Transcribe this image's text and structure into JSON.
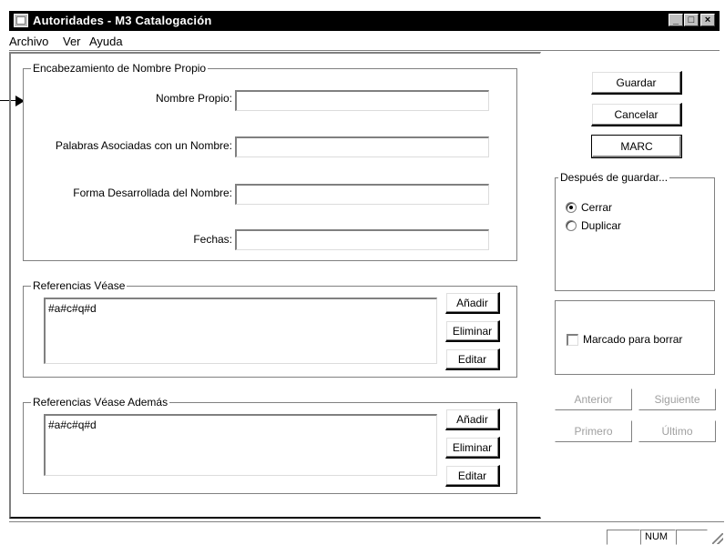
{
  "window": {
    "title": "Autoridades  - M3 Catalogación",
    "minimize_glyph": "_",
    "maximize_glyph": "□",
    "close_glyph": "×"
  },
  "menu": {
    "items": [
      "Archivo",
      "Ver",
      "Ayuda"
    ]
  },
  "heading_group": {
    "label": "Encabezamiento de Nombre Propio",
    "fields": [
      {
        "label": "Nombre Propio:",
        "value": ""
      },
      {
        "label": "Palabras Asociadas con un Nombre:",
        "value": ""
      },
      {
        "label": "Forma Desarrollada del Nombre:",
        "value": ""
      },
      {
        "label": "Fechas:",
        "value": ""
      }
    ]
  },
  "see_refs": {
    "label": "Referencias Véase",
    "content": "#a#c#q#d",
    "add_label": "Añadir",
    "delete_label": "Eliminar",
    "edit_label": "Editar"
  },
  "see_also_refs": {
    "label": "Referencias Véase Además",
    "content": "#a#c#q#d",
    "add_label": "Añadir",
    "delete_label": "Eliminar",
    "edit_label": "Editar"
  },
  "actions": {
    "save_label": "Guardar",
    "cancel_label": "Cancelar",
    "marc_label": "MARC"
  },
  "after_save": {
    "label": "Después de guardar...",
    "options": [
      {
        "label": "Cerrar",
        "selected": true
      },
      {
        "label": "Duplicar",
        "selected": false
      }
    ]
  },
  "delete_mark": {
    "label": "Marcado para borrar",
    "checked": false
  },
  "navigation": {
    "previous_label": "Anterior",
    "next_label": "Siguiente",
    "first_label": "Primero",
    "last_label": "Último"
  },
  "statusbar": {
    "num_indicator": "NUM"
  }
}
